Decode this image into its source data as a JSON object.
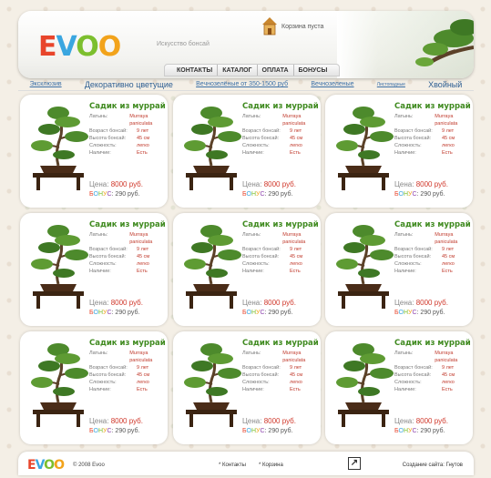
{
  "header": {
    "logo_letters": [
      "E",
      "V",
      "O",
      "O"
    ],
    "slogan": "Искусство бонсай",
    "cart_text": "Корзина пуста",
    "nav": [
      "КОНТАКТЫ",
      "КАТАЛОГ",
      "ОПЛАТА",
      "БОНУСЫ"
    ]
  },
  "categories": [
    "Эксклюзив",
    "Декоративно цветущие",
    "Вечнозелёные от 350-1500 руб",
    "Вечнозеленые",
    "Листопадные",
    "Хвойный"
  ],
  "card": {
    "title": "Садик из муррай",
    "rows": [
      {
        "k": "Латынь:",
        "v": "Murraya paniculata"
      },
      {
        "k": "Возраст бонсай:",
        "v": "9 лет"
      },
      {
        "k": "Высота бонсай:",
        "v": "45 см"
      },
      {
        "k": "Сложность:",
        "v": "легко"
      },
      {
        "k": "Наличие:",
        "v": "Есть"
      }
    ],
    "price_label": "Цена:",
    "price_value": "8000 руб.",
    "bonus_word": [
      "Б",
      "О",
      "Н",
      "У",
      "С"
    ],
    "bonus_value": ": 290 руб."
  },
  "footer": {
    "logo_letters": [
      "E",
      "V",
      "O",
      "O"
    ],
    "copyright": "© 2008 Evoo",
    "links": [
      "Контакты",
      "Корзина"
    ],
    "credit": "Создание сайта: Гнутов"
  },
  "colors": {
    "accent_green": "#3f8a1f",
    "price_red": "#d0382b",
    "link_blue": "#3b6fa6"
  }
}
